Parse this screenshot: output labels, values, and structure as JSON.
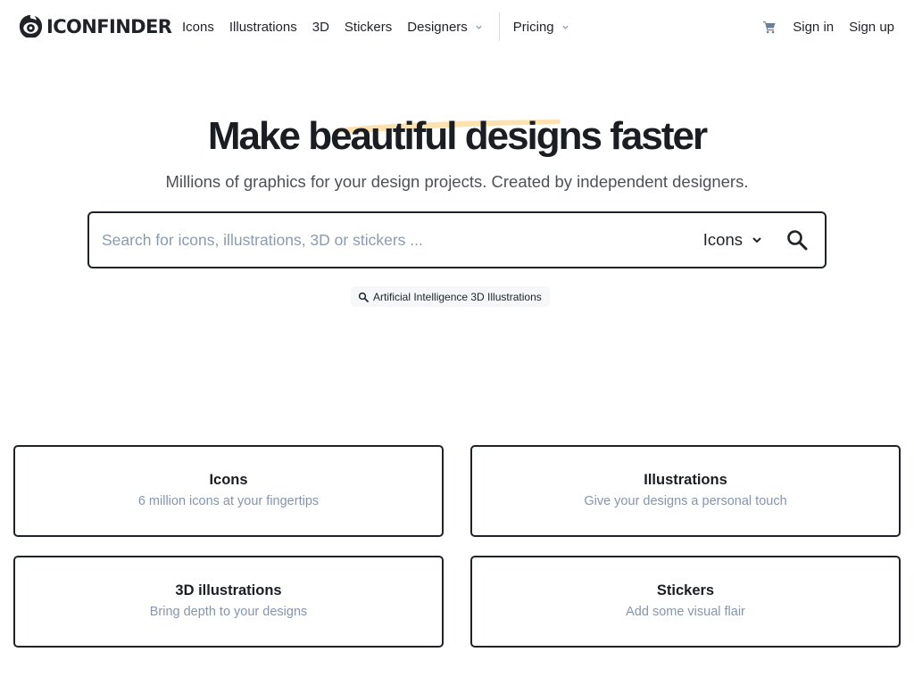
{
  "header": {
    "logo_text": "ICONFINDER",
    "nav": [
      {
        "label": "Icons",
        "has_dropdown": false
      },
      {
        "label": "Illustrations",
        "has_dropdown": false
      },
      {
        "label": "3D",
        "has_dropdown": false
      },
      {
        "label": "Stickers",
        "has_dropdown": false
      },
      {
        "label": "Designers",
        "has_dropdown": true
      },
      {
        "label": "Pricing",
        "has_dropdown": true
      }
    ],
    "cart_icon": "shopping-cart-icon",
    "sign_in": "Sign in",
    "sign_up": "Sign up"
  },
  "hero": {
    "title_before": "Make ",
    "title_highlight": "beautiful designs",
    "title_after": " faster",
    "highlight_color": "#fde2b0",
    "subtitle": "Millions of graphics for your design projects. Created by independent designers."
  },
  "search": {
    "placeholder": "Search for icons, illustrations, 3D or stickers ...",
    "value": "",
    "type_selected": "Icons",
    "search_icon": "search-icon"
  },
  "suggestion": {
    "label": "Artificial Intelligence 3D Illustrations"
  },
  "categories": [
    {
      "title": "Icons",
      "subtitle": "6 million icons at your fingertips"
    },
    {
      "title": "Illustrations",
      "subtitle": "Give your designs a personal touch"
    },
    {
      "title": "3D illustrations",
      "subtitle": "Bring depth to your designs"
    },
    {
      "title": "Stickers",
      "subtitle": "Add some visual flair"
    }
  ],
  "colors": {
    "text_primary": "#1a1d21",
    "text_muted": "#8396ad",
    "placeholder": "#8a9bb0",
    "highlight": "#fde2b0"
  }
}
